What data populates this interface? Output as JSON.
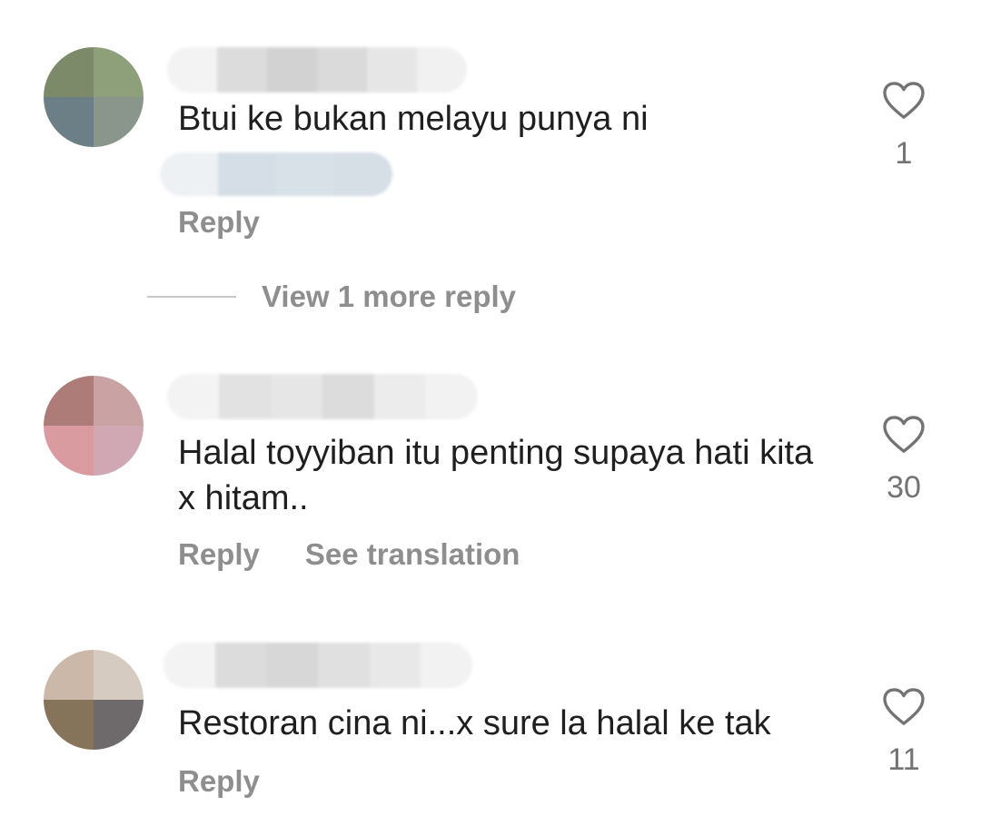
{
  "comments": [
    {
      "text": "Btui ke bukan melayu punya ni",
      "reply_label": "Reply",
      "like_count": "1",
      "like_icon": "heart-outline-icon"
    },
    {
      "text": "Halal toyyiban itu penting supaya hati kita x hitam..",
      "reply_label": "Reply",
      "translation_label": "See translation",
      "like_count": "30",
      "like_icon": "heart-outline-icon"
    },
    {
      "text": "Restoran cina ni...x sure la halal ke tak",
      "reply_label": "Reply",
      "like_count": "11",
      "like_icon": "heart-outline-icon"
    }
  ],
  "view_more_replies": "View 1 more reply"
}
